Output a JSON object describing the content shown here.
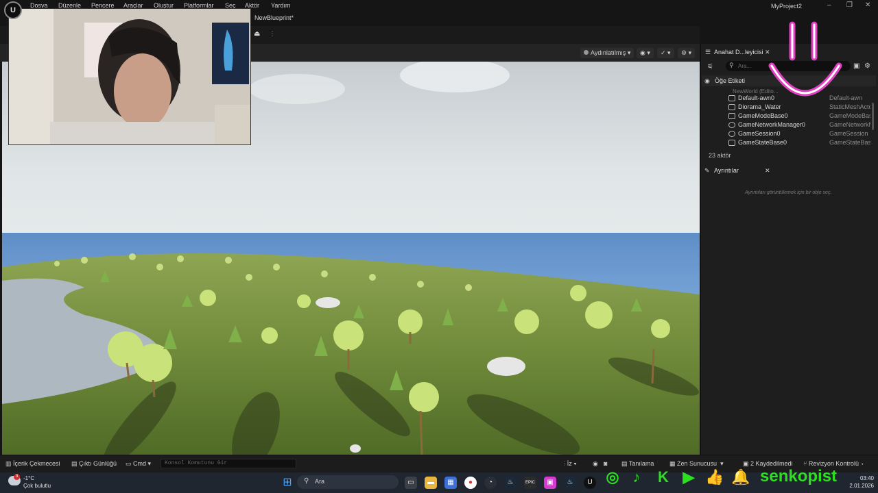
{
  "menu": {
    "items": [
      "Dosya",
      "Düzenle",
      "Pencere",
      "Araçlar",
      "Oluştur",
      "Platformlar",
      "Seç",
      "Aktör",
      "Yardım"
    ],
    "project": "MyProject2"
  },
  "tabs": {
    "blueprint": "NewBlueprint*"
  },
  "viewport": {
    "lit_mode": "Aydınlatılmış"
  },
  "outliner": {
    "title": "Anahat D...leyicisi",
    "search_placeholder": "Ara...",
    "column_label": "Öğe Etiketi",
    "world": "NewWorld (Edito...",
    "rows": [
      {
        "label": "Default-awn0",
        "type": "Default-awn"
      },
      {
        "label": "Diorama_Water",
        "type": "StaticMeshActo"
      },
      {
        "label": "GameModeBase0",
        "type": "GameModeBase"
      },
      {
        "label": "GameNetworkManager0",
        "type": "GameNetworkM"
      },
      {
        "label": "GameSession0",
        "type": "GameSession"
      },
      {
        "label": "GameStateBase0",
        "type": "GameStateBase"
      }
    ],
    "actor_count": "23 aktör"
  },
  "details": {
    "title": "Ayrıntılar",
    "hint": "Ayrıntıları görüntülemek için bir obje seç."
  },
  "statusbar": {
    "content_drawer": "İçerik Çekmecesi",
    "output_log": "Çıktı Günlüğü",
    "cmd": "Cmd",
    "console_placeholder": "Konsol Komutunu Gir",
    "trace": "İz",
    "diagnostics": "Tanılama",
    "zen_server": "Zen Sunucusu",
    "saved": "2 Kaydedilmedi",
    "revision": "Revizyon Kontrolü"
  },
  "taskbar": {
    "temperature": "-1°C",
    "weather": "Çok bulutlu",
    "search": "Ara",
    "time": "03:40",
    "date": "2.01.2026",
    "notification_count": "3"
  },
  "overlay": {
    "handle": "senkopist"
  }
}
